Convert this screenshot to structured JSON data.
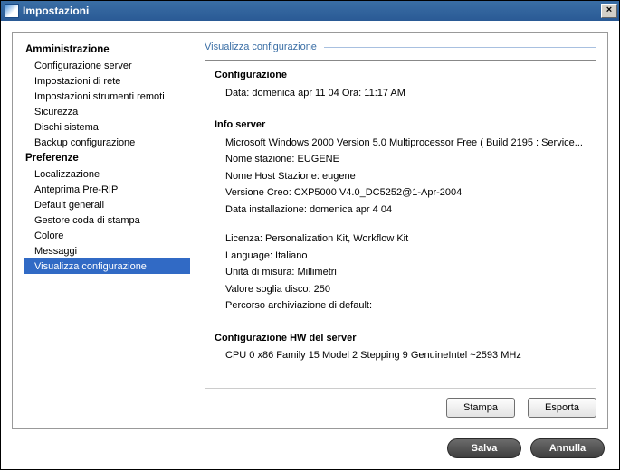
{
  "window": {
    "title": "Impostazioni",
    "close_label": "×"
  },
  "sidebar": {
    "groups": [
      {
        "header": "Amministrazione",
        "items": [
          {
            "label": "Configurazione server",
            "selected": false
          },
          {
            "label": "Impostazioni di rete",
            "selected": false
          },
          {
            "label": "Impostazioni strumenti remoti",
            "selected": false
          },
          {
            "label": "Sicurezza",
            "selected": false
          },
          {
            "label": "Dischi sistema",
            "selected": false
          },
          {
            "label": "Backup configurazione",
            "selected": false
          }
        ]
      },
      {
        "header": "Preferenze",
        "items": [
          {
            "label": "Localizzazione",
            "selected": false
          },
          {
            "label": "Anteprima Pre-RIP",
            "selected": false
          },
          {
            "label": "Default generali",
            "selected": false
          },
          {
            "label": "Gestore coda di stampa",
            "selected": false
          },
          {
            "label": "Colore",
            "selected": false
          },
          {
            "label": "Messaggi",
            "selected": false
          },
          {
            "label": "Visualizza configurazione",
            "selected": true
          }
        ]
      }
    ]
  },
  "section": {
    "title": "Visualizza configurazione"
  },
  "config": {
    "h_config": "Configurazione",
    "date_line": "Data:  domenica apr 11 04       Ora:  11:17 AM",
    "h_server": "Info server",
    "os_line": "Microsoft Windows 2000 Version 5.0 Multiprocessor Free ( Build 2195 : Service...",
    "station_name": "Nome stazione:  EUGENE",
    "host_name": "Nome Host Stazione:  eugene",
    "creo_version": "Versione Creo:  CXP5000 V4.0_DC5252@1-Apr-2004",
    "install_date": "Data installazione:  domenica apr 4 04",
    "license": "Licenza:  Personalization Kit, Workflow Kit",
    "language": "Language: Italiano",
    "units": "Unità di misura:  Millimetri",
    "disk_threshold": "Valore soglia disco:  250",
    "default_archive": "Percorso archiviazione di default:",
    "h_hw": "Configurazione HW del server",
    "cpu_line": "CPU 0 x86 Family 15 Model 2 Stepping 9 GenuineIntel ~2593 MHz"
  },
  "buttons": {
    "print": "Stampa",
    "export": "Esporta",
    "save": "Salva",
    "cancel": "Annulla"
  }
}
